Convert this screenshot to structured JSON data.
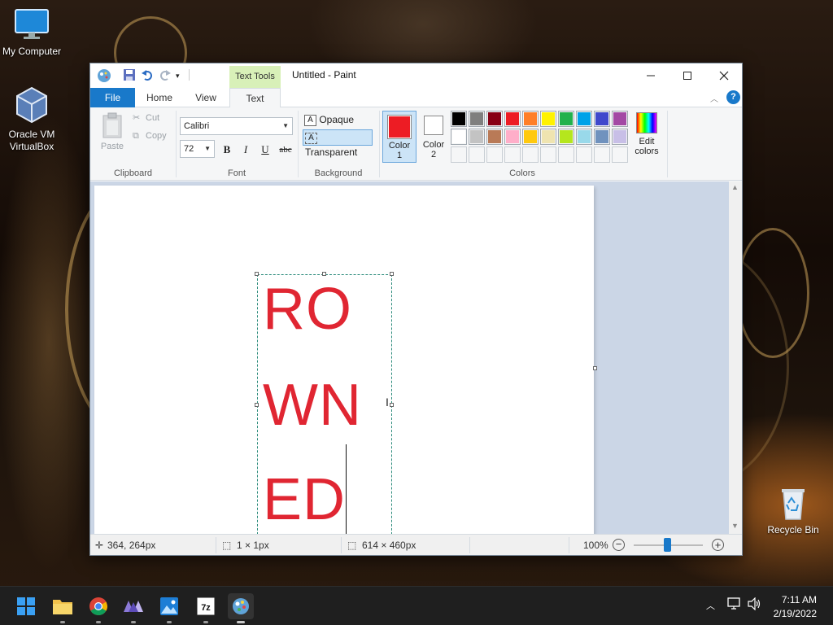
{
  "desktop": {
    "icons": [
      {
        "label": "My Computer"
      },
      {
        "label": "Oracle VM\nVirtualBox"
      },
      {
        "label": "Recycle Bin"
      }
    ]
  },
  "paint": {
    "title": "Untitled - Paint",
    "contextual_tab": "Text Tools",
    "tabs": [
      "File",
      "Home",
      "View",
      "Text"
    ],
    "active_tab": "Text",
    "clipboard": {
      "paste": "Paste",
      "cut": "Cut",
      "copy": "Copy",
      "label": "Clipboard"
    },
    "font": {
      "family": "Calibri",
      "size": "72",
      "label": "Font",
      "bold": "B",
      "italic": "I",
      "underline": "U",
      "strike": "abc"
    },
    "background": {
      "opaque": "Opaque",
      "transparent": "Transparent",
      "label": "Background",
      "selected": "Transparent"
    },
    "colors": {
      "color1_label": "Color\n1",
      "color2_label": "Color\n2",
      "edit_label": "Edit\ncolors",
      "label": "Colors",
      "color1": "#ed1c24",
      "color2": "#ffffff",
      "palette_row1": [
        "#000000",
        "#7f7f7f",
        "#880015",
        "#ed1c24",
        "#ff7f27",
        "#fff200",
        "#22b14c",
        "#00a2e8",
        "#3f48cc",
        "#a349a4"
      ],
      "palette_row2": [
        "#ffffff",
        "#c3c3c3",
        "#b97a57",
        "#ffaec9",
        "#ffc90e",
        "#efe4b0",
        "#b5e61d",
        "#99d9ea",
        "#7092be",
        "#c8bfe7"
      ]
    },
    "canvas_text": [
      "RO",
      "WN",
      "ED"
    ],
    "text_color": "#e02632",
    "status": {
      "cursor_pos": "364, 264px",
      "selection_size": "1 × 1px",
      "image_size": "614 × 460px",
      "zoom": "100%"
    }
  },
  "taskbar": {
    "apps": [
      "start-icon",
      "file-explorer-icon",
      "chrome-icon",
      "app-icon",
      "photos-icon",
      "7zip-icon",
      "paint-icon"
    ],
    "time": "7:11 AM",
    "date": "2/19/2022"
  }
}
